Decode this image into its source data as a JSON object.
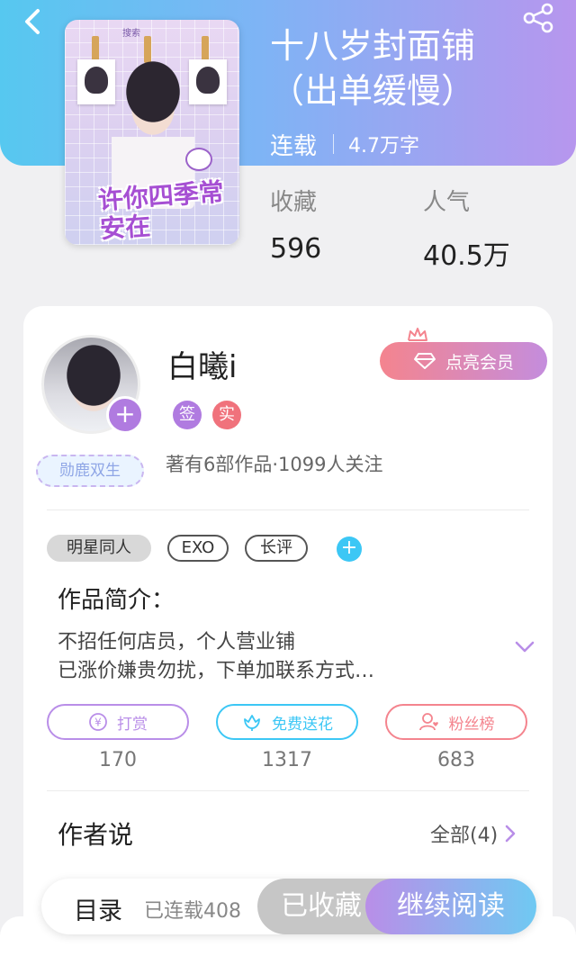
{
  "book": {
    "title": "十八岁封面铺（出单缓慢）",
    "serial_status": "连载",
    "word_count": "4.7万字",
    "cover_title": "许你四季常安在",
    "cover_top_text": "搜索"
  },
  "stats": {
    "collect_label": "收藏",
    "collect_value": "596",
    "popularity_label": "人气",
    "popularity_value": "40.5万"
  },
  "author": {
    "name": "白曦i",
    "badge_sign": "签",
    "badge_real": "实",
    "medal": "勋鹿双生",
    "meta": "著有6部作品·1099人关注",
    "vip_button": "点亮会员"
  },
  "tags": [
    "明星同人",
    "EXO",
    "长评"
  ],
  "intro": {
    "title": "作品简介：",
    "line1": "不招任何店员，个人营业铺",
    "line2": "已涨价嫌贵勿扰，下单加联系方式…"
  },
  "actions": [
    {
      "label": "打赏",
      "count": "170",
      "color": "#b98ee8"
    },
    {
      "label": "免费送花",
      "count": "1317",
      "color": "#3cc7f5"
    },
    {
      "label": "粉丝榜",
      "count": "683",
      "color": "#f4848e"
    }
  ],
  "author_says": {
    "title": "作者说",
    "all_link": "全部(4)"
  },
  "bottom": {
    "toc": "目录",
    "progress": "已连载408",
    "collected": "已收藏",
    "continue_read": "继续阅读"
  },
  "icons": {
    "back": "back-chevron-icon",
    "share": "share-icon",
    "diamond": "diamond-icon",
    "crown": "crown-icon",
    "yuan": "yuan-icon",
    "flower": "flower-icon",
    "fan": "fan-person-icon",
    "expand": "chevron-down-icon",
    "arrow": "chevron-right-icon"
  }
}
